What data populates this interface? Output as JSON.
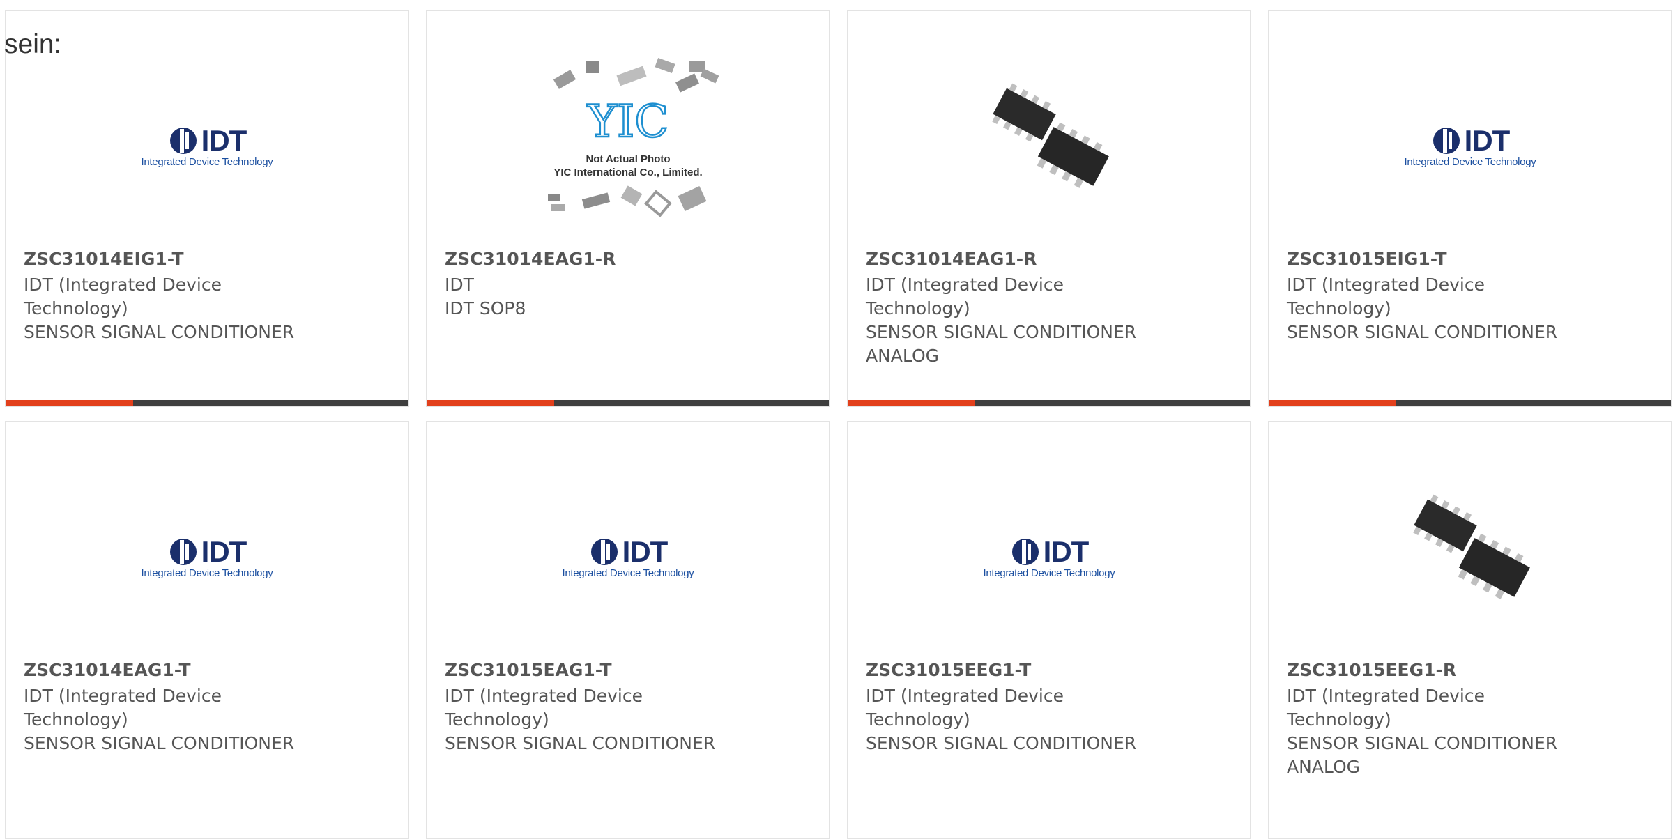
{
  "intro_text": "sein:",
  "logo": {
    "idt_word": "IDT",
    "idt_tagline": "Integrated Device Technology",
    "yic_letters": "YIC",
    "yic_caption_1": "Not Actual Photo",
    "yic_caption_2": "YIC International Co., Limited."
  },
  "colors": {
    "accent": "#e2401c",
    "bar": "#3f3f3f",
    "border": "#e3e3e3",
    "text": "#555555",
    "idt_blue": "#1b2f6b"
  },
  "products": [
    {
      "part_number": "ZSC31014EIG1-T",
      "image_icon": "idt-logo-icon",
      "lines": [
        "IDT (Integrated Device",
        "Technology)",
        "SENSOR SIGNAL CONDITIONER"
      ]
    },
    {
      "part_number": "ZSC31014EAG1-R",
      "image_icon": "yic-placeholder-icon",
      "lines": [
        "IDT",
        "IDT SOP8"
      ]
    },
    {
      "part_number": "ZSC31014EAG1-R",
      "image_icon": "sop8-chip-icon",
      "lines": [
        "IDT (Integrated Device",
        "Technology)",
        "SENSOR SIGNAL CONDITIONER",
        "ANALOG"
      ]
    },
    {
      "part_number": "ZSC31015EIG1-T",
      "image_icon": "idt-logo-icon",
      "lines": [
        "IDT (Integrated Device",
        "Technology)",
        "SENSOR SIGNAL CONDITIONER"
      ]
    },
    {
      "part_number": "ZSC31014EAG1-T",
      "image_icon": "idt-logo-icon",
      "lines": [
        "IDT (Integrated Device",
        "Technology)",
        "SENSOR SIGNAL CONDITIONER"
      ]
    },
    {
      "part_number": "ZSC31015EAG1-T",
      "image_icon": "idt-logo-icon",
      "lines": [
        "IDT (Integrated Device",
        "Technology)",
        "SENSOR SIGNAL CONDITIONER"
      ]
    },
    {
      "part_number": "ZSC31015EEG1-T",
      "image_icon": "idt-logo-icon",
      "lines": [
        "IDT (Integrated Device",
        "Technology)",
        "SENSOR SIGNAL CONDITIONER"
      ]
    },
    {
      "part_number": "ZSC31015EEG1-R",
      "image_icon": "sop8-chip-icon",
      "lines": [
        "IDT (Integrated Device",
        "Technology)",
        "SENSOR SIGNAL CONDITIONER",
        "ANALOG"
      ]
    }
  ]
}
